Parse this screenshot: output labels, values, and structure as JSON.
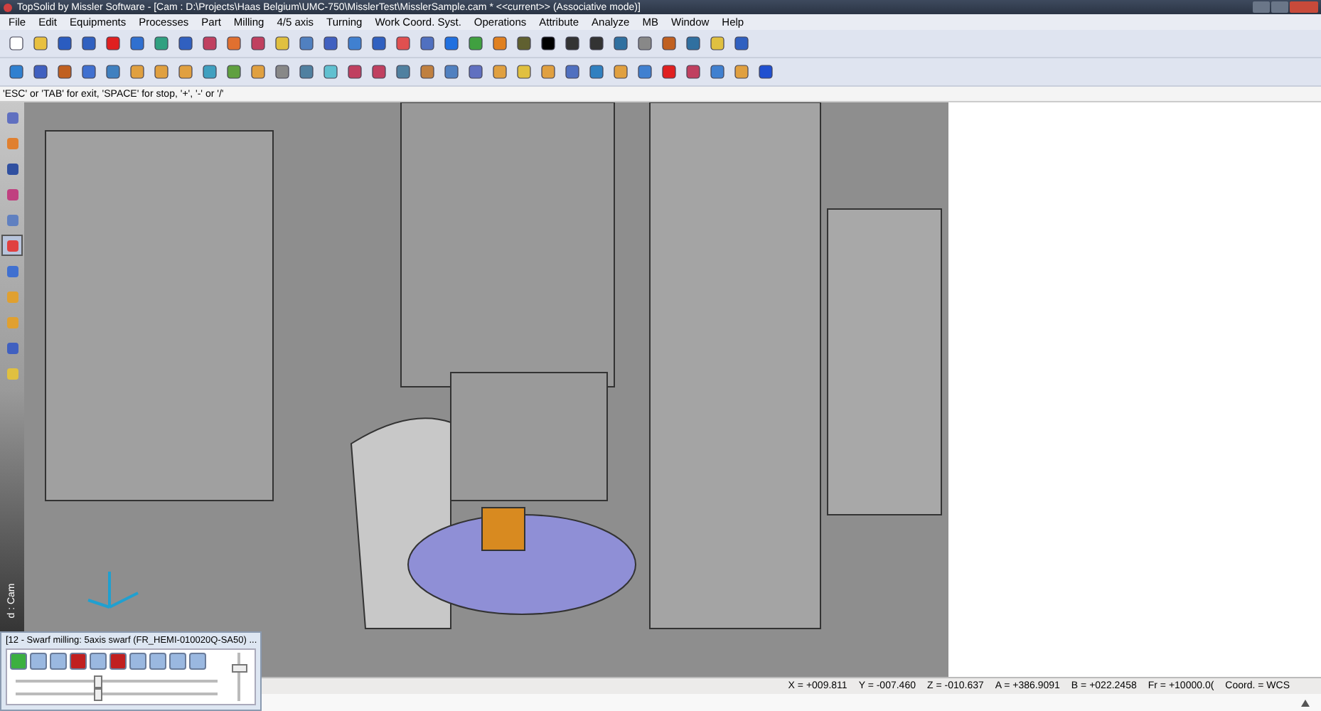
{
  "window": {
    "title": "TopSolid by Missler Software - [Cam : D:\\Projects\\Haas Belgium\\UMC-750\\MisslerTest\\MisslerSample.cam *  <<current>> (Associative mode)]"
  },
  "menu": [
    "File",
    "Edit",
    "Equipments",
    "Processes",
    "Part",
    "Milling",
    "4/5 axis",
    "Turning",
    "Work Coord. Syst.",
    "Operations",
    "Attribute",
    "Analyze",
    "MB",
    "Window",
    "Help"
  ],
  "prompt": "'ESC' or 'TAB' for exit, 'SPACE' for stop, '+', '-' or '/'",
  "left_toolbar": [
    {
      "selected": false
    },
    {
      "selected": false
    },
    {
      "selected": false
    },
    {
      "selected": false
    },
    {
      "selected": false
    },
    {
      "selected": true
    },
    {
      "selected": false
    },
    {
      "selected": false
    },
    {
      "selected": false
    },
    {
      "selected": false
    },
    {
      "selected": false
    }
  ],
  "side_tab": "d : Cam",
  "simulation_panel": {
    "title": "[12 - Swarf milling: 5axis swarf   (FR_HEMI-010020Q-SA50) ...",
    "sliders": [
      {
        "level": 0.4
      },
      {
        "level": 0.4
      }
    ],
    "speed": {
      "level": 0.7
    }
  },
  "status_bar": [
    "X = +009.811",
    "Y = -007.460",
    "Z = -010.637",
    "A = +386.9091",
    "B = +022.2458",
    "Fr = +10000.0(",
    "Coord. = WCS"
  ]
}
